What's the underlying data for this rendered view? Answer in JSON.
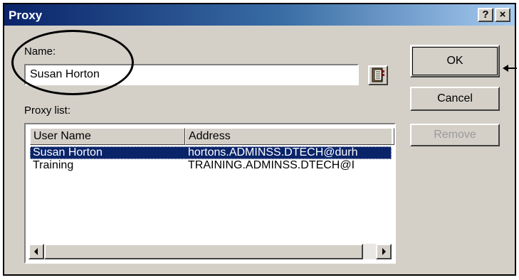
{
  "dialog": {
    "title": "Proxy",
    "help_label": "?",
    "close_label": "×"
  },
  "name": {
    "label": "Name:",
    "value": "Susan Horton"
  },
  "proxy_list": {
    "label": "Proxy list:",
    "columns": [
      "User Name",
      "Address"
    ],
    "rows": [
      {
        "user": "Susan Horton",
        "address": "hortons.ADMINSS.DTECH@durh",
        "selected": true
      },
      {
        "user": "Training",
        "address": "TRAINING.ADMINSS.DTECH@I",
        "selected": false
      }
    ]
  },
  "buttons": {
    "ok": "OK",
    "cancel": "Cancel",
    "remove": "Remove"
  },
  "icons": {
    "address_book": "address-book-icon",
    "scroll_left": "scroll-left-arrow-icon",
    "scroll_right": "scroll-right-arrow-icon",
    "annotation_arrow": "pointer-arrow-icon"
  },
  "colors": {
    "title_start": "#0a246a",
    "title_end": "#a6caf0",
    "selection": "#0a246a",
    "face": "#d4d0c8"
  }
}
